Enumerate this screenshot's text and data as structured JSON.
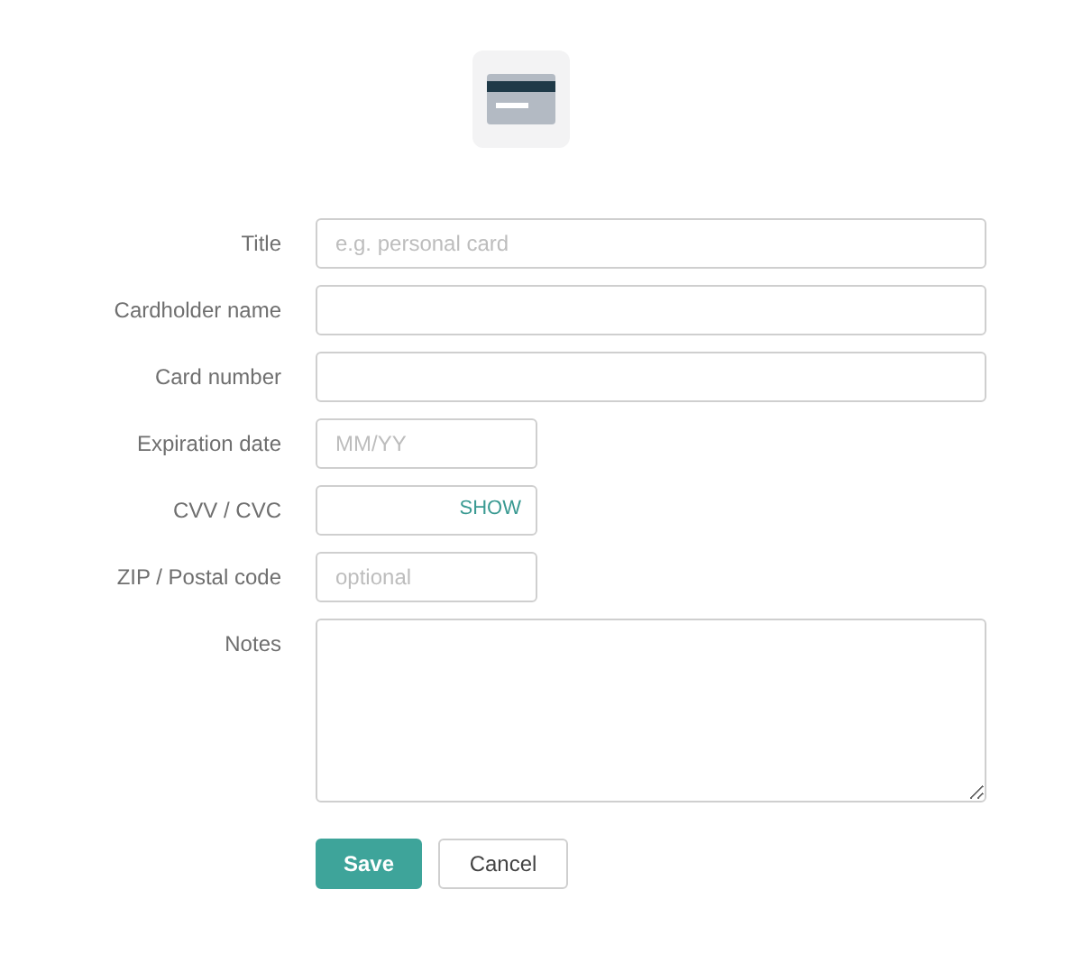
{
  "fields": [
    {
      "label": "Title",
      "kind": "text",
      "placeholder": "e.g. personal card"
    },
    {
      "label": "Cardholder name",
      "kind": "text"
    },
    {
      "label": "Card number",
      "kind": "text"
    },
    {
      "label": "Expiration date",
      "kind": "short",
      "placeholder": "MM/YY"
    },
    {
      "label": "CVV / CVC",
      "kind": "secret",
      "toggle": "SHOW"
    },
    {
      "label": "ZIP / Postal code",
      "kind": "short",
      "placeholder": "optional"
    },
    {
      "label": "Notes",
      "kind": "textarea"
    }
  ],
  "buttons": [
    {
      "label": "Save",
      "kind": "primary"
    },
    {
      "label": "Cancel",
      "kind": "secondary"
    }
  ]
}
